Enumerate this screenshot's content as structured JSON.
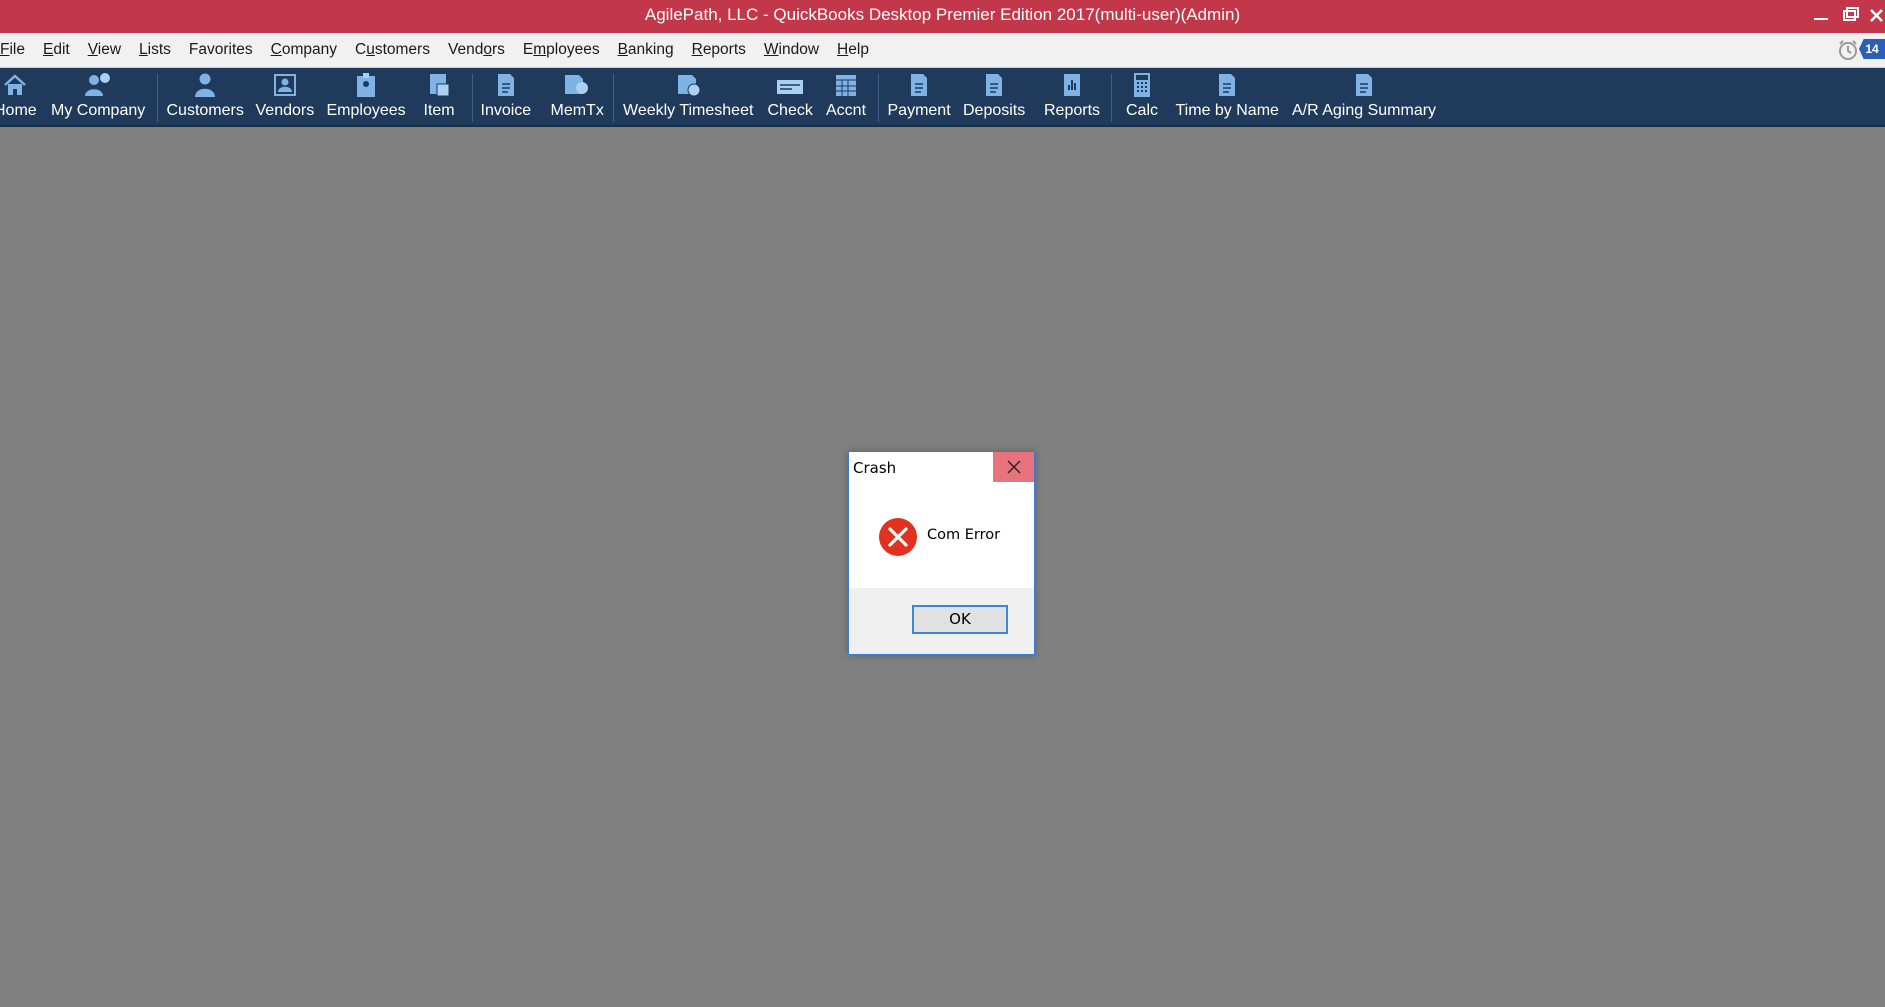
{
  "window": {
    "title": "AgilePath, LLC  - QuickBooks Desktop Premier Edition 2017(multi-user)(Admin)",
    "controls": [
      "minimize-icon",
      "restore-icon",
      "close-icon"
    ]
  },
  "menubar": {
    "items": [
      {
        "label": "File",
        "ul": "F"
      },
      {
        "label": "Edit",
        "ul": "E"
      },
      {
        "label": "View",
        "ul": "V"
      },
      {
        "label": "Lists",
        "ul": "L"
      },
      {
        "label": "Favorites",
        "ul": ""
      },
      {
        "label": "Company",
        "ul": "C"
      },
      {
        "label": "Customers",
        "ul": "u"
      },
      {
        "label": "Vendors",
        "ul": "o"
      },
      {
        "label": "Employees",
        "ul": "m"
      },
      {
        "label": "Banking",
        "ul": "B"
      },
      {
        "label": "Reports",
        "ul": "R"
      },
      {
        "label": "Window",
        "ul": "W"
      },
      {
        "label": "Help",
        "ul": "H"
      }
    ],
    "reminder_count": "14"
  },
  "toolbar": {
    "buttons": [
      {
        "label": "Home",
        "icon": "home-icon"
      },
      {
        "label": "My Company",
        "icon": "my-company-icon"
      },
      {
        "label": "Customers",
        "icon": "customer-icon"
      },
      {
        "label": "Vendors",
        "icon": "vendor-icon"
      },
      {
        "label": "Employees",
        "icon": "employee-icon"
      },
      {
        "label": "Item",
        "icon": "item-icon"
      },
      {
        "label": "Invoice",
        "icon": "invoice-icon"
      },
      {
        "label": "MemTx",
        "icon": "memorized-transactions-icon"
      },
      {
        "label": "Weekly Timesheet",
        "icon": "timesheet-icon"
      },
      {
        "label": "Check",
        "icon": "check-icon"
      },
      {
        "label": "Accnt",
        "icon": "account-icon"
      },
      {
        "label": "Payment",
        "icon": "payment-icon"
      },
      {
        "label": "Deposits",
        "icon": "deposits-icon"
      },
      {
        "label": "Reports",
        "icon": "reports-icon"
      },
      {
        "label": "Calc",
        "icon": "calculator-icon"
      },
      {
        "label": "Time by Name",
        "icon": "time-by-name-icon"
      },
      {
        "label": "A/R Aging Summary",
        "icon": "ar-aging-icon"
      }
    ]
  },
  "dialog": {
    "title": "Crash",
    "message": "Com Error",
    "ok_label": "OK",
    "icon": "error-icon"
  },
  "colors": {
    "titlebar": "#c2384a",
    "toolbar": "#1f3a5a",
    "workspace": "#808080",
    "dialog_close": "#e8737d",
    "error_red": "#e0321e"
  }
}
